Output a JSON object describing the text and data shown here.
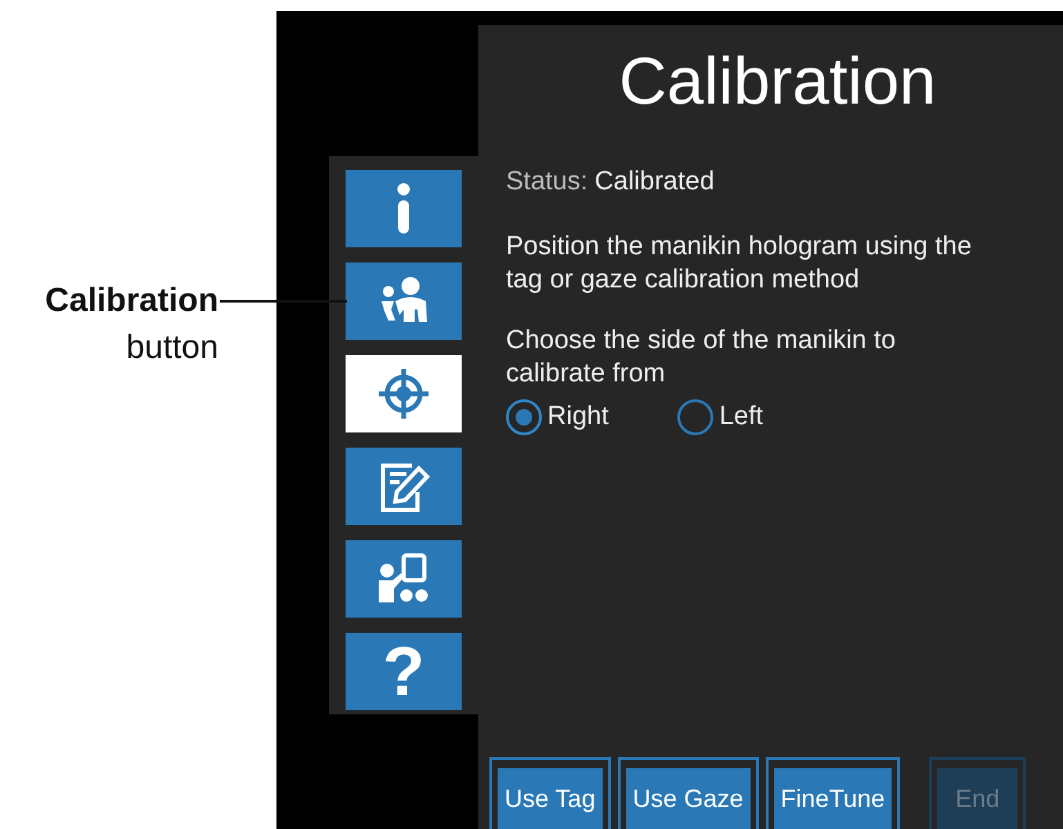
{
  "annotation": {
    "label": "Calibration",
    "note": "button"
  },
  "sidebar": {
    "buttons": [
      {
        "kind": "info",
        "selected": false
      },
      {
        "kind": "people",
        "selected": false
      },
      {
        "kind": "target",
        "selected": true
      },
      {
        "kind": "edit",
        "selected": false
      },
      {
        "kind": "presenter",
        "selected": false
      },
      {
        "kind": "help",
        "glyph": "?",
        "selected": false
      }
    ]
  },
  "panel": {
    "title": "Calibration",
    "status_label": "Status:",
    "status_value": "Calibrated",
    "instruction": "Position the manikin hologram using the tag or gaze calibration method",
    "side_prompt": "Choose the side of the manikin to calibrate from",
    "sides": [
      {
        "label": "Right",
        "selected": true
      },
      {
        "label": "Left",
        "selected": false
      }
    ],
    "buttons": [
      {
        "label": "Use Tag",
        "disabled": false
      },
      {
        "label": "Use Gaze",
        "disabled": false
      },
      {
        "label": "FineTune",
        "disabled": false
      },
      {
        "label": "End",
        "disabled": true
      }
    ]
  }
}
